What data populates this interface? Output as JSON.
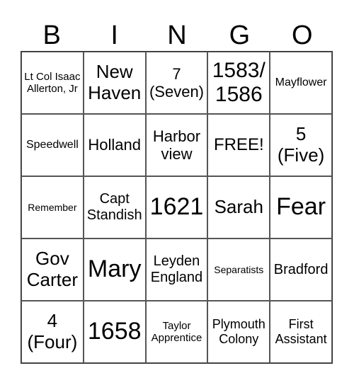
{
  "header": [
    "B",
    "I",
    "N",
    "G",
    "O"
  ],
  "cells": [
    [
      "Lt Col Isaac Allerton, Jr",
      "New Haven",
      "7 (Seven)",
      "1583/ 1586",
      "Mayflower"
    ],
    [
      "Speedwell",
      "Holland",
      "Harbor view",
      "FREE!",
      "5 (Five)"
    ],
    [
      "Remember",
      "Capt Standish",
      "1621",
      "Sarah",
      "Fear"
    ],
    [
      "Gov Carter",
      "Mary",
      "Leyden England",
      "Separatists",
      "Bradford"
    ],
    [
      "4 (Four)",
      "1658",
      "Taylor Apprentice",
      "Plymouth Colony",
      "First Assistant"
    ]
  ]
}
